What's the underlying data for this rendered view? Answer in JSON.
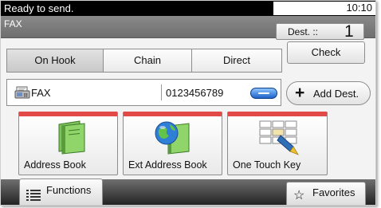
{
  "status": {
    "message": "Ready to send.",
    "time": "10:10"
  },
  "header": {
    "title": "FAX",
    "dest_label": "Dest. ::",
    "dest_count": "1"
  },
  "transmit_modes": [
    {
      "label": "On Hook",
      "selected": true
    },
    {
      "label": "Chain",
      "selected": false
    },
    {
      "label": "Direct",
      "selected": false
    }
  ],
  "check_label": "Check",
  "destination": {
    "type_label": "FAX",
    "number": "0123456789",
    "type_icon": "fax-icon"
  },
  "add_dest": {
    "icon": "plus-icon",
    "label": "Add Dest."
  },
  "shortcuts": [
    {
      "label": "Address Book",
      "icon": "address-book-icon"
    },
    {
      "label": "Ext Address Book",
      "icon": "ext-address-book-icon"
    },
    {
      "label": "One Touch Key",
      "icon": "one-touch-key-icon"
    }
  ],
  "bottom": {
    "functions_label": "Functions",
    "functions_icon": "list-icon",
    "favorites_label": "Favorites",
    "favorites_icon": "star-icon"
  },
  "colors": {
    "accent_red": "#e24a47",
    "oval_blue": "#1e63c8",
    "status_bar": "#000000"
  }
}
